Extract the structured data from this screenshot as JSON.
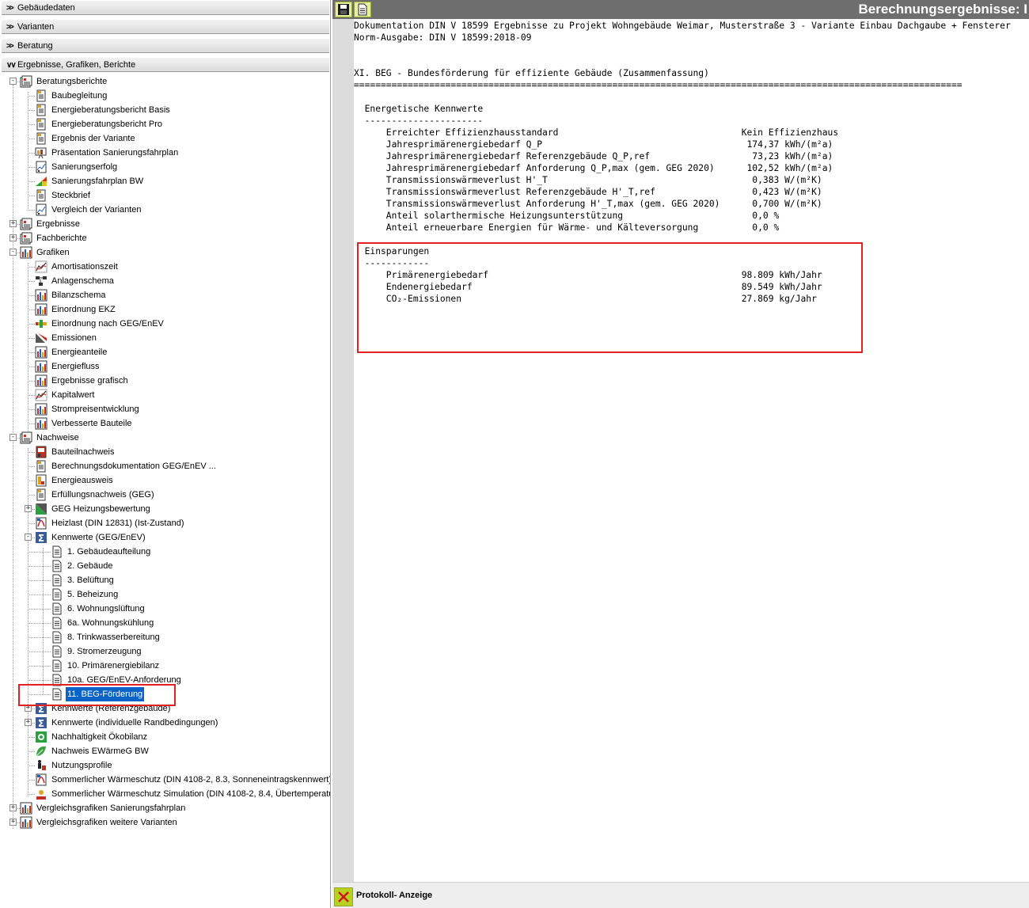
{
  "accordion": [
    {
      "label": "Gebäudedaten"
    },
    {
      "label": "Varianten"
    },
    {
      "label": "Beratung"
    },
    {
      "label": "Ergebnisse, Grafiken, Berichte"
    }
  ],
  "tree": [
    {
      "label": "Beratungsberichte",
      "level": 0,
      "exp": "-",
      "icon": "report-folder-icon"
    },
    {
      "label": "Baubegleitung",
      "level": 1,
      "icon": "document-icon"
    },
    {
      "label": "Energieberatungsbericht Basis",
      "level": 1,
      "icon": "document-icon"
    },
    {
      "label": "Energieberatungsbericht Pro",
      "level": 1,
      "icon": "document-icon"
    },
    {
      "label": "Ergebnis der Variante",
      "level": 1,
      "icon": "document-icon"
    },
    {
      "label": "Präsentation Sanierungsfahrplan",
      "level": 1,
      "icon": "presentation-icon"
    },
    {
      "label": "Sanierungserfolg",
      "level": 1,
      "icon": "chart-icon"
    },
    {
      "label": "Sanierungsfahrplan BW",
      "level": 1,
      "icon": "roadmap-icon"
    },
    {
      "label": "Steckbrief",
      "level": 1,
      "icon": "document-icon"
    },
    {
      "label": "Vergleich der Varianten",
      "level": 1,
      "icon": "chart-icon"
    },
    {
      "label": "Ergebnisse",
      "level": 0,
      "exp": "+",
      "icon": "report-folder-icon"
    },
    {
      "label": "Fachberichte",
      "level": 0,
      "exp": "+",
      "icon": "report-folder-icon"
    },
    {
      "label": "Grafiken",
      "level": 0,
      "exp": "-",
      "icon": "bar-chart-icon"
    },
    {
      "label": "Amortisationszeit",
      "level": 1,
      "icon": "line-chart-icon"
    },
    {
      "label": "Anlagenschema",
      "level": 1,
      "icon": "schema-icon"
    },
    {
      "label": "Bilanzschema",
      "level": 1,
      "icon": "bar-chart-icon"
    },
    {
      "label": "Einordnung EKZ",
      "level": 1,
      "icon": "bar-chart-icon"
    },
    {
      "label": "Einordnung nach GEG/EnEV",
      "level": 1,
      "icon": "scale-icon"
    },
    {
      "label": "Emissionen",
      "level": 1,
      "icon": "emissions-icon"
    },
    {
      "label": "Energieanteile",
      "level": 1,
      "icon": "bar-chart-icon"
    },
    {
      "label": "Energiefluss",
      "level": 1,
      "icon": "bar-chart-icon"
    },
    {
      "label": "Ergebnisse grafisch",
      "level": 1,
      "icon": "bar-chart-icon"
    },
    {
      "label": "Kapitalwert",
      "level": 1,
      "icon": "line-chart-icon"
    },
    {
      "label": "Strompreisentwicklung",
      "level": 1,
      "icon": "bar-chart-icon"
    },
    {
      "label": "Verbesserte Bauteile",
      "level": 1,
      "icon": "bar-chart-icon"
    },
    {
      "label": "Nachweise",
      "level": 0,
      "exp": "-",
      "icon": "report-folder-icon"
    },
    {
      "label": "Bauteilnachweis",
      "level": 1,
      "icon": "component-icon"
    },
    {
      "label": "Berechnungsdokumentation GEG/EnEV ...",
      "level": 1,
      "icon": "document-icon"
    },
    {
      "label": "Energieausweis",
      "level": 1,
      "icon": "certificate-icon"
    },
    {
      "label": "Erfüllungsnachweis (GEG)",
      "level": 1,
      "icon": "document-icon"
    },
    {
      "label": "GEG Heizungsbewertung",
      "level": 1,
      "exp": "+",
      "icon": "heating-icon"
    },
    {
      "label": "Heizlast (DIN 12831) (Ist-Zustand)",
      "level": 1,
      "icon": "pdf-icon"
    },
    {
      "label": "Kennwerte (GEG/EnEV)",
      "level": 1,
      "exp": "-",
      "icon": "sigma-icon"
    },
    {
      "label": "1. Gebäudeaufteilung",
      "level": 2,
      "icon": "page-icon"
    },
    {
      "label": "2. Gebäude",
      "level": 2,
      "icon": "page-icon"
    },
    {
      "label": "3. Belüftung",
      "level": 2,
      "icon": "page-icon"
    },
    {
      "label": "5. Beheizung",
      "level": 2,
      "icon": "page-icon"
    },
    {
      "label": "6. Wohnungslüftung",
      "level": 2,
      "icon": "page-icon"
    },
    {
      "label": "6a. Wohnungskühlung",
      "level": 2,
      "icon": "page-icon"
    },
    {
      "label": "8. Trinkwasserbereitung",
      "level": 2,
      "icon": "page-icon"
    },
    {
      "label": "9. Stromerzeugung",
      "level": 2,
      "icon": "page-icon"
    },
    {
      "label": "10. Primärenergiebilanz",
      "level": 2,
      "icon": "page-icon"
    },
    {
      "label": "10a. GEG/EnEV-Anforderung",
      "level": 2,
      "icon": "page-icon"
    },
    {
      "label": "11. BEG-Förderung",
      "level": 2,
      "icon": "page-icon",
      "selected": true
    },
    {
      "label": "Kennwerte (Referenzgebäude)",
      "level": 1,
      "exp": "+",
      "icon": "sigma-icon"
    },
    {
      "label": "Kennwerte (individuelle Randbedingungen)",
      "level": 1,
      "exp": "+",
      "icon": "sigma-icon"
    },
    {
      "label": "Nachhaltigkeit Ökobilanz",
      "level": 1,
      "icon": "eco-icon"
    },
    {
      "label": "Nachweis EWärmeG BW",
      "level": 1,
      "icon": "leaf-icon"
    },
    {
      "label": "Nutzungsprofile",
      "level": 1,
      "icon": "person-icon"
    },
    {
      "label": "Sommerlicher Wärmeschutz (DIN 4108-2, 8.3, Sonneneintragskennwert)",
      "level": 1,
      "icon": "pdf-icon"
    },
    {
      "label": "Sommerlicher Wärmeschutz Simulation (DIN 4108-2, 8.4, Übertemperatur",
      "level": 1,
      "icon": "sun-icon"
    },
    {
      "label": "Vergleichsgrafiken Sanierungsfahrplan",
      "level": 0,
      "exp": "+",
      "icon": "bar-chart-icon"
    },
    {
      "label": "Vergleichsgrafiken weitere Varianten",
      "level": 0,
      "exp": "+",
      "icon": "bar-chart-icon"
    }
  ],
  "right": {
    "title": "Berechnungsergebnisse: I",
    "status_label": "Protokoll- Anzeige"
  },
  "doc_lines": [
    {
      "row": 0,
      "text": "Dokumentation DIN V 18599 Ergebnisse zu Projekt Wohngebäude Weimar, Musterstraße 3 - Variante Einbau Dachgaube + Fensterer"
    },
    {
      "row": 1,
      "text": "Norm-Ausgabe: DIN V 18599:2018-09"
    },
    {
      "row": 4,
      "text": "XI. BEG - Bundesförderung für effiziente Gebäude (Zusammenfassung)"
    },
    {
      "row": 5,
      "text": "================================================================================================================="
    },
    {
      "row": 7,
      "text": "  Energetische Kennwerte"
    },
    {
      "row": 8,
      "text": "  ----------------------"
    },
    {
      "row": 9,
      "text": "      Erreichter Effizienzhausstandard                                  Kein Effizienzhaus"
    },
    {
      "row": 10,
      "text": "      Jahresprimärenergiebedarf Q_P                                      174,37 kWh/(m²a)"
    },
    {
      "row": 11,
      "text": "      Jahresprimärenergiebedarf Referenzgebäude Q_P,ref                   73,23 kWh/(m²a)"
    },
    {
      "row": 12,
      "text": "      Jahresprimärenergiebedarf Anforderung Q_P,max (gem. GEG 2020)      102,52 kWh/(m²a)"
    },
    {
      "row": 13,
      "text": "      Transmissionswärmeverlust H'_T                                      0,383 W/(m²K)"
    },
    {
      "row": 14,
      "text": "      Transmissionswärmeverlust Referenzgebäude H'_T,ref                  0,423 W/(m²K)"
    },
    {
      "row": 15,
      "text": "      Transmissionswärmeverlust Anforderung H'_T,max (gem. GEG 2020)      0,700 W/(m²K)"
    },
    {
      "row": 16,
      "text": "      Anteil solarthermische Heizungsunterstützung                        0,0 %"
    },
    {
      "row": 17,
      "text": "      Anteil erneuerbare Energien für Wärme- und Kälteversorgung          0,0 %"
    },
    {
      "row": 19,
      "text": "  Einsparungen"
    },
    {
      "row": 20,
      "text": "  ------------"
    },
    {
      "row": 21,
      "text": "      Primärenergiebedarf                                               98.809 kWh/Jahr"
    },
    {
      "row": 22,
      "text": "      Endenergiebedarf                                                  89.549 kWh/Jahr"
    },
    {
      "row": 23,
      "text": "      CO₂-Emissionen                                                    27.869 kg/Jahr"
    }
  ]
}
